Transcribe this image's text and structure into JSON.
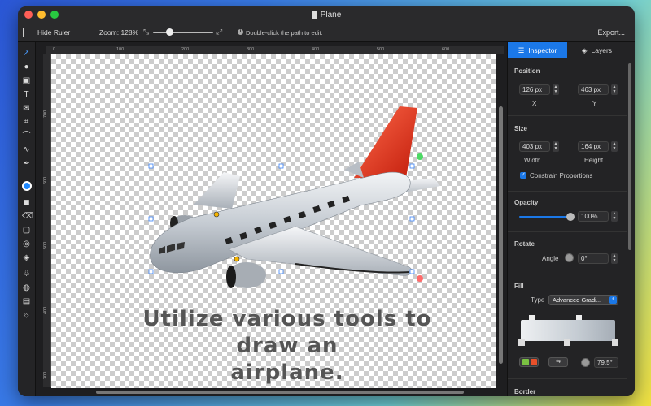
{
  "window": {
    "title": "Plane"
  },
  "toolbar": {
    "hide_ruler": "Hide Ruler",
    "zoom_label": "Zoom: 128%",
    "hint": "Double-click the path to edit.",
    "export": "Export..."
  },
  "ruler": {
    "top_ticks": [
      "0",
      "100",
      "200",
      "300",
      "400",
      "500",
      "600"
    ],
    "left_ticks": [
      "700",
      "600",
      "500",
      "400",
      "300"
    ]
  },
  "canvas": {
    "caption_line1": "Utilize various tools to draw an",
    "caption_line2": "airplane."
  },
  "tabs": {
    "inspector": "Inspector",
    "layers": "Layers"
  },
  "inspector": {
    "position": {
      "title": "Position",
      "x": "126 px",
      "y": "463 px",
      "x_label": "X",
      "y_label": "Y"
    },
    "size": {
      "title": "Size",
      "width": "403 px",
      "height": "164 px",
      "width_label": "Width",
      "height_label": "Height",
      "constrain": "Constrain Proportions"
    },
    "opacity": {
      "title": "Opacity",
      "value": "100%",
      "level": 1.0
    },
    "rotate": {
      "title": "Rotate",
      "angle_label": "Angle",
      "angle": "0°"
    },
    "fill": {
      "title": "Fill",
      "type_label": "Type",
      "type_value": "Advanced Gradi...",
      "angle": "79.5°"
    },
    "border": {
      "title": "Border"
    }
  },
  "colors": {
    "accent": "#1b78e8",
    "tail": "#e03a1e",
    "fuselage": "#c8cdd4"
  }
}
